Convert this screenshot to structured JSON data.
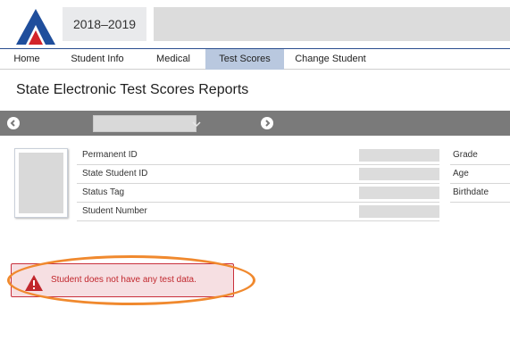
{
  "header": {
    "school_year": "2018–2019"
  },
  "nav": {
    "items": [
      {
        "label": "Home"
      },
      {
        "label": "Student Info"
      },
      {
        "label": "Medical"
      },
      {
        "label": "Test Scores"
      },
      {
        "label": "Change Student"
      }
    ],
    "active": "Test Scores"
  },
  "page": {
    "title": "State Electronic Test Scores Reports"
  },
  "student": {
    "fields": [
      {
        "label": "Permanent ID"
      },
      {
        "label": "State Student ID"
      },
      {
        "label": "Status Tag"
      },
      {
        "label": "Student Number"
      }
    ],
    "side_fields": [
      {
        "label": "Grade"
      },
      {
        "label": "Age"
      },
      {
        "label": "Birthdate"
      }
    ]
  },
  "alert": {
    "message": "Student does not have any test data."
  },
  "colors": {
    "brand_blue": "#1f4e9c",
    "brand_red": "#d2232a",
    "active_tab": "#b9c8df",
    "alert_text": "#c1272d",
    "highlight": "#f0892e"
  },
  "icons": {
    "logo": "aeries-a-logo",
    "prev": "chevron-left-circle-icon",
    "next": "chevron-right-circle-icon",
    "dropdown": "chevron-down-icon",
    "alert": "warning-triangle-icon"
  }
}
